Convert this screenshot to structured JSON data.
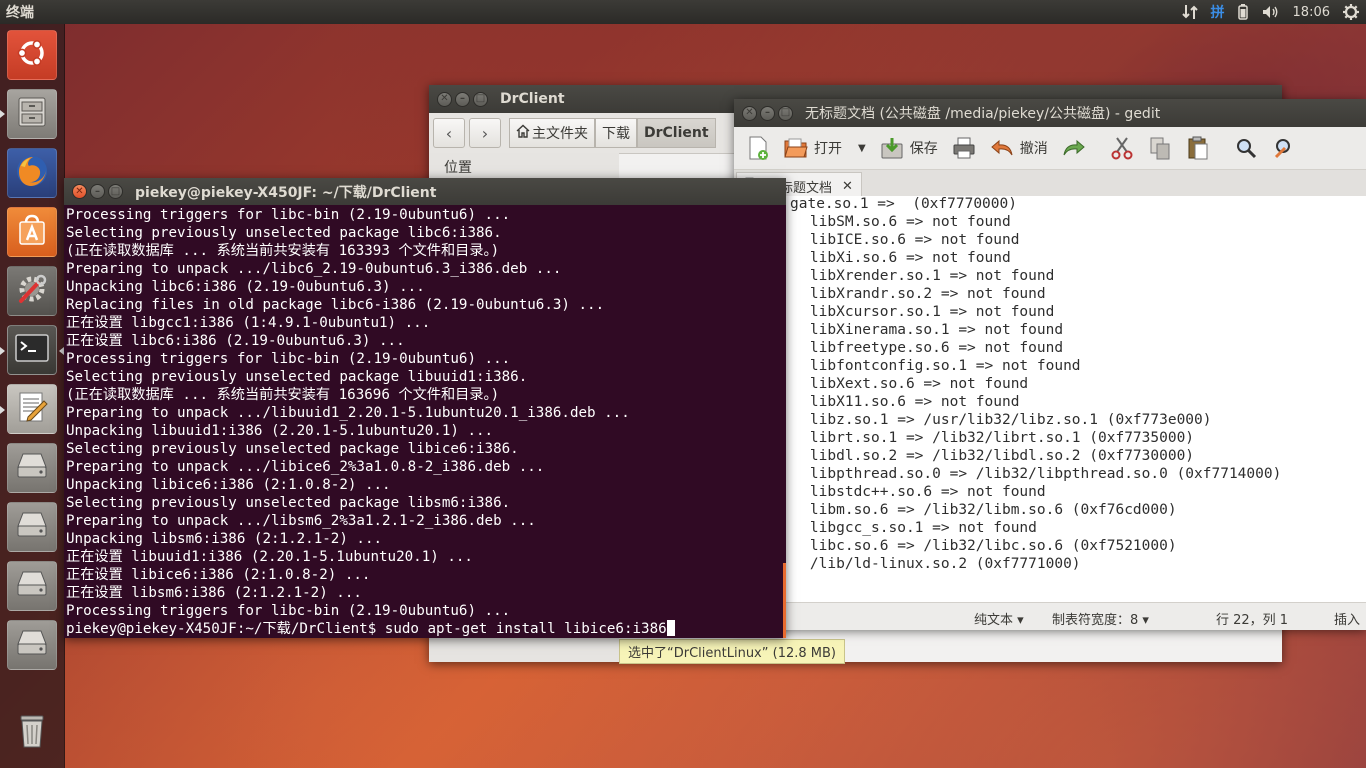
{
  "top_panel": {
    "app_title": "终端",
    "ime_label": "拼",
    "clock": "18:06"
  },
  "launcher": {
    "items": [
      {
        "name": "Dash"
      },
      {
        "name": "Files"
      },
      {
        "name": "Firefox"
      },
      {
        "name": "Ubuntu Software Center"
      },
      {
        "name": "System Settings"
      },
      {
        "name": "Terminal"
      },
      {
        "name": "Text Editor"
      },
      {
        "name": "Drive 1"
      },
      {
        "name": "Drive 2"
      },
      {
        "name": "Drive 3"
      },
      {
        "name": "Drive 4"
      },
      {
        "name": "Trash"
      }
    ]
  },
  "file_manager": {
    "title": "DrClient",
    "breadcrumbs": [
      "主文件夹",
      "下载",
      "DrClient"
    ],
    "sidebar_heading": "位置",
    "status": "选中了“DrClientLinux” (12.8 MB)"
  },
  "gedit": {
    "title": "无标题文档 (公共磁盘 /media/piekey/公共磁盘) - gedit",
    "toolbar": {
      "open": "打开",
      "save": "保存",
      "undo": "撤消"
    },
    "tab_label": "无标题文档",
    "lines": [
      "gate.so.1 =>  (0xf7770000)",
      "    libSM.so.6 => not found",
      "    libICE.so.6 => not found",
      "    libXi.so.6 => not found",
      "    libXrender.so.1 => not found",
      "    libXrandr.so.2 => not found",
      "    libXcursor.so.1 => not found",
      "    libXinerama.so.1 => not found",
      "    libfreetype.so.6 => not found",
      "    libfontconfig.so.1 => not found",
      "    libXext.so.6 => not found",
      "    libX11.so.6 => not found",
      "    libz.so.1 => /usr/lib32/libz.so.1 (0xf773e000)",
      "    librt.so.1 => /lib32/librt.so.1 (0xf7735000)",
      "    libdl.so.2 => /lib32/libdl.so.2 (0xf7730000)",
      "    libpthread.so.0 => /lib32/libpthread.so.0 (0xf7714000)",
      "    libstdc++.so.6 => not found",
      "    libm.so.6 => /lib32/libm.so.6 (0xf76cd000)",
      "    libgcc_s.so.1 => not found",
      "    libc.so.6 => /lib32/libc.so.6 (0xf7521000)",
      "    /lib/ld-linux.so.2 (0xf7771000)"
    ],
    "status": {
      "syntax": "纯文本 ▾",
      "tab_width": "制表符宽度：8 ▾",
      "position": "行 22，列 1",
      "mode": "插入"
    }
  },
  "terminal": {
    "title": "piekey@piekey-X450JF: ~/下载/DrClient",
    "lines": [
      "Processing triggers for libc-bin (2.19-0ubuntu6) ...",
      "Selecting previously unselected package libc6:i386.",
      "(正在读取数据库 ... 系统当前共安装有 163393 个文件和目录。)",
      "Preparing to unpack .../libc6_2.19-0ubuntu6.3_i386.deb ...",
      "Unpacking libc6:i386 (2.19-0ubuntu6.3) ...",
      "Replacing files in old package libc6-i386 (2.19-0ubuntu6.3) ...",
      "正在设置 libgcc1:i386 (1:4.9.1-0ubuntu1) ...",
      "正在设置 libc6:i386 (2.19-0ubuntu6.3) ...",
      "Processing triggers for libc-bin (2.19-0ubuntu6) ...",
      "Selecting previously unselected package libuuid1:i386.",
      "(正在读取数据库 ... 系统当前共安装有 163696 个文件和目录。)",
      "Preparing to unpack .../libuuid1_2.20.1-5.1ubuntu20.1_i386.deb ...",
      "Unpacking libuuid1:i386 (2.20.1-5.1ubuntu20.1) ...",
      "Selecting previously unselected package libice6:i386.",
      "Preparing to unpack .../libice6_2%3a1.0.8-2_i386.deb ...",
      "Unpacking libice6:i386 (2:1.0.8-2) ...",
      "Selecting previously unselected package libsm6:i386.",
      "Preparing to unpack .../libsm6_2%3a1.2.1-2_i386.deb ...",
      "Unpacking libsm6:i386 (2:1.2.1-2) ...",
      "正在设置 libuuid1:i386 (2.20.1-5.1ubuntu20.1) ...",
      "正在设置 libice6:i386 (2:1.0.8-2) ...",
      "正在设置 libsm6:i386 (2:1.2.1-2) ...",
      "Processing triggers for libc-bin (2.19-0ubuntu6) ..."
    ],
    "prompt": "piekey@piekey-X450JF:~/下载/DrClient$ ",
    "command": "sudo apt-get install libice6:i386"
  },
  "colors": {
    "terminal_bg": "#300a24",
    "panel_bg": "#3c3b37",
    "accent": "#e86a2f"
  }
}
